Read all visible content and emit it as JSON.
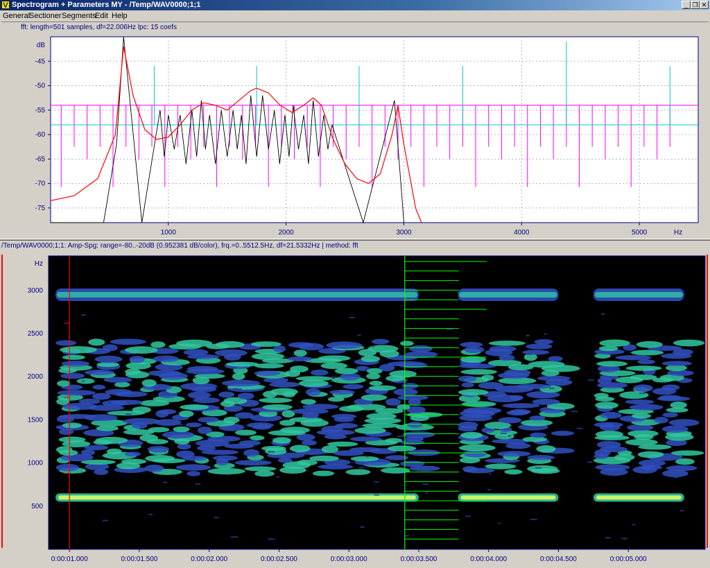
{
  "window": {
    "title": "Spectrogram + Parameters MY - /Temp/WAV0000;1;1",
    "icon": "app-v-icon",
    "controls": [
      "minimize",
      "restore",
      "close"
    ]
  },
  "menu": [
    "General",
    "Sectioner",
    "Segments",
    "Edit",
    "Help"
  ],
  "fft_panel": {
    "info": "fft: length=501 samples, df=22.006Hz lpc: 15 coefs",
    "y_unit": "dB",
    "y_ticks": [
      "-45",
      "-50",
      "-55",
      "-60",
      "-65",
      "-70",
      "-75"
    ],
    "x_ticks": [
      "1000",
      "2000",
      "3000",
      "4000",
      "5000"
    ],
    "x_unit": "Hz",
    "colors": {
      "fft": "#000000",
      "lpc": "#ff0000",
      "harmonics": "#ff00ff",
      "formants": "#00c8c8",
      "background": "#ffffff"
    }
  },
  "spectrogram_panel": {
    "info": "/Temp/WAV0000;1;1: Amp-Spg: range=-80..-20dB (0.952381 dB/color), frq.=0..5512.5Hz, df=21.5332Hz | method: fft",
    "y_unit": "Hz",
    "y_ticks": [
      "3000",
      "2500",
      "2000",
      "1500",
      "1000",
      "500"
    ],
    "x_ticks": [
      "0:00:01.000",
      "0:00:01.500",
      "0:00:02.000",
      "0:00:02.500",
      "0:00:03.000",
      "0:00:03.500",
      "0:00:04.000",
      "0:00:04.500",
      "0:00:05.000"
    ],
    "colors": {
      "background": "#000000",
      "cursor": "#ff0000",
      "section_marker": "#00ff00",
      "energy_high": "#e8ff60",
      "energy_mid": "#30c8a0",
      "energy_low": "#3050c0"
    }
  },
  "chart_data": [
    {
      "type": "line",
      "title": "",
      "xlabel": "Hz",
      "ylabel": "dB",
      "xlim": [
        0,
        5500
      ],
      "ylim": [
        -78,
        -40
      ],
      "grid": true,
      "series": [
        {
          "values_lpc": [
            [
              0,
              -73.5
            ],
            [
              200,
              -72.5
            ],
            [
              400,
              -69
            ],
            [
              550,
              -60
            ],
            [
              620,
              -42
            ],
            [
              700,
              -52
            ],
            [
              800,
              -59
            ],
            [
              900,
              -61
            ],
            [
              1000,
              -60.5
            ],
            [
              1100,
              -58
            ],
            [
              1200,
              -55
            ],
            [
              1300,
              -53.5
            ],
            [
              1400,
              -54
            ],
            [
              1500,
              -55
            ],
            [
              1600,
              -53
            ],
            [
              1700,
              -51
            ],
            [
              1750,
              -50.5
            ],
            [
              1850,
              -51.5
            ],
            [
              1950,
              -54
            ],
            [
              2050,
              -55.5
            ],
            [
              2150,
              -54
            ],
            [
              2230,
              -52.5
            ],
            [
              2300,
              -54
            ],
            [
              2400,
              -61
            ],
            [
              2500,
              -66
            ],
            [
              2600,
              -69
            ],
            [
              2700,
              -70
            ],
            [
              2800,
              -68
            ],
            [
              2900,
              -60
            ],
            [
              2950,
              -54
            ],
            [
              3000,
              -62
            ],
            [
              3100,
              -75
            ],
            [
              3150,
              -78
            ]
          ]
        },
        {
          "values_fft_peaks": [
            [
              620,
              -40
            ],
            [
              930,
              -55
            ],
            [
              1000,
              -56
            ],
            [
              1100,
              -56
            ],
            [
              1200,
              -55
            ],
            [
              1280,
              -53
            ],
            [
              1350,
              -56
            ],
            [
              1450,
              -55
            ],
            [
              1550,
              -55
            ],
            [
              1620,
              -56
            ],
            [
              1700,
              -52
            ],
            [
              1800,
              -52
            ],
            [
              1900,
              -55
            ],
            [
              1990,
              -56
            ],
            [
              2060,
              -54
            ],
            [
              2150,
              -56
            ],
            [
              2230,
              -53
            ],
            [
              2320,
              -56
            ],
            [
              2390,
              -58
            ],
            [
              2920,
              -53
            ]
          ]
        },
        {
          "harmonics_hz": [
            90,
            200,
            310,
            420,
            530,
            640,
            750,
            860,
            970,
            1080,
            1190,
            1300,
            1410,
            1520,
            1630,
            1740,
            1850,
            1960,
            2070,
            2180,
            2290,
            2400,
            2510,
            2620,
            2730,
            2840,
            2950,
            3060,
            3170,
            3280,
            3390,
            3500,
            3610,
            3720,
            3830,
            3940,
            4050,
            4160,
            4270,
            4380,
            4490,
            4600,
            4710,
            4820,
            4930,
            5040,
            5150,
            5260
          ]
        },
        {
          "formants_hz": [
            880,
            1750,
            2620,
            3500,
            4380,
            5260
          ]
        }
      ]
    },
    {
      "type": "heatmap",
      "title": "",
      "xlabel": "",
      "ylabel": "Hz",
      "ylim": [
        0,
        3400
      ],
      "xlim_seconds": [
        0.85,
        5.55
      ],
      "grid": false,
      "voiced_segments_seconds": [
        [
          0.9,
          3.5
        ],
        [
          3.78,
          4.5
        ],
        [
          4.75,
          5.4
        ]
      ],
      "bands_hz": [
        {
          "f": 600,
          "strength": "high"
        },
        {
          "f": 2950,
          "strength": "mid"
        },
        {
          "f_range": [
            900,
            2400
          ],
          "strength": "mid-low"
        }
      ],
      "cursor_time_seconds": 1.0,
      "marker_time_seconds": 3.4
    }
  ]
}
